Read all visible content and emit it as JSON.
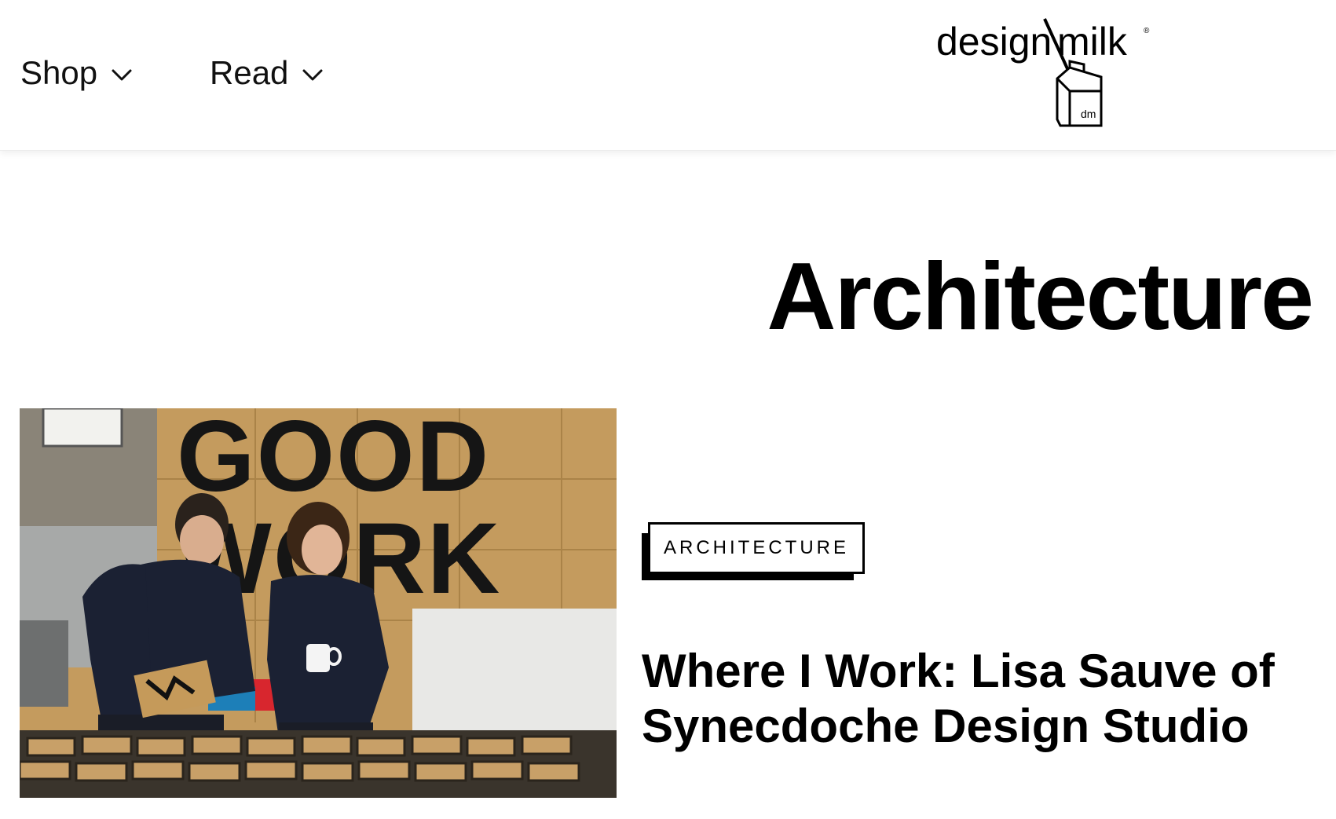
{
  "header": {
    "nav": [
      {
        "label": "Shop",
        "icon": "chevron-down-icon"
      },
      {
        "label": "Read",
        "icon": "chevron-down-icon"
      }
    ],
    "logo": {
      "text_left": "design",
      "text_right": "milk",
      "carton_label": "dm",
      "registered_mark": "®"
    }
  },
  "page": {
    "title": "Architecture"
  },
  "article": {
    "tag": "ARCHITECTURE",
    "title": "Where I Work: Lisa Sauve of Synecdoche Design Studio",
    "image": {
      "wall_text_line1": "GOOD",
      "wall_text_line2": "WORK"
    }
  },
  "colors": {
    "text": "#000000",
    "background": "#ffffff",
    "plywood": "#c8a36a"
  }
}
